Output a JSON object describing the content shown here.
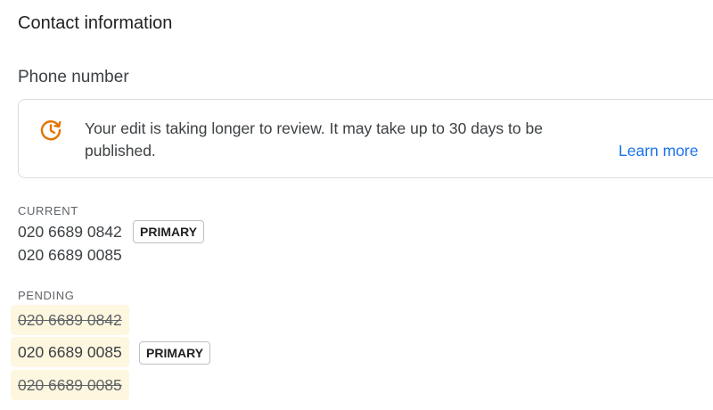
{
  "section": {
    "title": "Contact information"
  },
  "field": {
    "title": "Phone number"
  },
  "notice": {
    "icon": "clock-refresh-icon",
    "icon_color": "#e37400",
    "message": "Your edit is taking longer to review. It may take up to 30 days to be published.",
    "link_label": "Learn more",
    "link_color": "#1a73e8"
  },
  "current": {
    "label": "CURRENT",
    "numbers": [
      {
        "value": "020 6689 0842",
        "badge": "PRIMARY"
      },
      {
        "value": "020 6689 0085",
        "badge": ""
      }
    ]
  },
  "pending": {
    "label": "PENDING",
    "highlight_color": "#fef7e0",
    "numbers": [
      {
        "value": "020 6689 0842",
        "status": "removed",
        "badge": ""
      },
      {
        "value": "020 6689 0085",
        "status": "added",
        "badge": "PRIMARY"
      },
      {
        "value": "020 6689 0085",
        "status": "removed",
        "badge": ""
      }
    ]
  }
}
